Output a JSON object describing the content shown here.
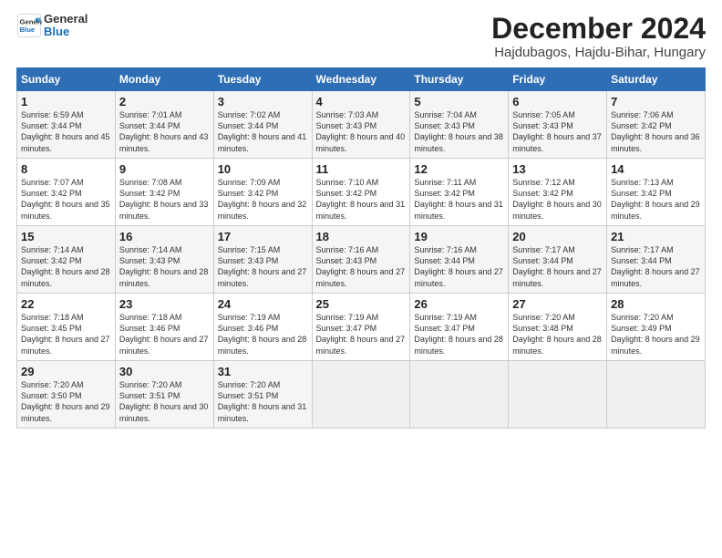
{
  "logo": {
    "text_general": "General",
    "text_blue": "Blue"
  },
  "header": {
    "month": "December 2024",
    "location": "Hajdubagos, Hajdu-Bihar, Hungary"
  },
  "weekdays": [
    "Sunday",
    "Monday",
    "Tuesday",
    "Wednesday",
    "Thursday",
    "Friday",
    "Saturday"
  ],
  "weeks": [
    [
      {
        "day": "1",
        "sunrise": "Sunrise: 6:59 AM",
        "sunset": "Sunset: 3:44 PM",
        "daylight": "Daylight: 8 hours and 45 minutes."
      },
      {
        "day": "2",
        "sunrise": "Sunrise: 7:01 AM",
        "sunset": "Sunset: 3:44 PM",
        "daylight": "Daylight: 8 hours and 43 minutes."
      },
      {
        "day": "3",
        "sunrise": "Sunrise: 7:02 AM",
        "sunset": "Sunset: 3:44 PM",
        "daylight": "Daylight: 8 hours and 41 minutes."
      },
      {
        "day": "4",
        "sunrise": "Sunrise: 7:03 AM",
        "sunset": "Sunset: 3:43 PM",
        "daylight": "Daylight: 8 hours and 40 minutes."
      },
      {
        "day": "5",
        "sunrise": "Sunrise: 7:04 AM",
        "sunset": "Sunset: 3:43 PM",
        "daylight": "Daylight: 8 hours and 38 minutes."
      },
      {
        "day": "6",
        "sunrise": "Sunrise: 7:05 AM",
        "sunset": "Sunset: 3:43 PM",
        "daylight": "Daylight: 8 hours and 37 minutes."
      },
      {
        "day": "7",
        "sunrise": "Sunrise: 7:06 AM",
        "sunset": "Sunset: 3:42 PM",
        "daylight": "Daylight: 8 hours and 36 minutes."
      }
    ],
    [
      {
        "day": "8",
        "sunrise": "Sunrise: 7:07 AM",
        "sunset": "Sunset: 3:42 PM",
        "daylight": "Daylight: 8 hours and 35 minutes."
      },
      {
        "day": "9",
        "sunrise": "Sunrise: 7:08 AM",
        "sunset": "Sunset: 3:42 PM",
        "daylight": "Daylight: 8 hours and 33 minutes."
      },
      {
        "day": "10",
        "sunrise": "Sunrise: 7:09 AM",
        "sunset": "Sunset: 3:42 PM",
        "daylight": "Daylight: 8 hours and 32 minutes."
      },
      {
        "day": "11",
        "sunrise": "Sunrise: 7:10 AM",
        "sunset": "Sunset: 3:42 PM",
        "daylight": "Daylight: 8 hours and 31 minutes."
      },
      {
        "day": "12",
        "sunrise": "Sunrise: 7:11 AM",
        "sunset": "Sunset: 3:42 PM",
        "daylight": "Daylight: 8 hours and 31 minutes."
      },
      {
        "day": "13",
        "sunrise": "Sunrise: 7:12 AM",
        "sunset": "Sunset: 3:42 PM",
        "daylight": "Daylight: 8 hours and 30 minutes."
      },
      {
        "day": "14",
        "sunrise": "Sunrise: 7:13 AM",
        "sunset": "Sunset: 3:42 PM",
        "daylight": "Daylight: 8 hours and 29 minutes."
      }
    ],
    [
      {
        "day": "15",
        "sunrise": "Sunrise: 7:14 AM",
        "sunset": "Sunset: 3:42 PM",
        "daylight": "Daylight: 8 hours and 28 minutes."
      },
      {
        "day": "16",
        "sunrise": "Sunrise: 7:14 AM",
        "sunset": "Sunset: 3:43 PM",
        "daylight": "Daylight: 8 hours and 28 minutes."
      },
      {
        "day": "17",
        "sunrise": "Sunrise: 7:15 AM",
        "sunset": "Sunset: 3:43 PM",
        "daylight": "Daylight: 8 hours and 27 minutes."
      },
      {
        "day": "18",
        "sunrise": "Sunrise: 7:16 AM",
        "sunset": "Sunset: 3:43 PM",
        "daylight": "Daylight: 8 hours and 27 minutes."
      },
      {
        "day": "19",
        "sunrise": "Sunrise: 7:16 AM",
        "sunset": "Sunset: 3:44 PM",
        "daylight": "Daylight: 8 hours and 27 minutes."
      },
      {
        "day": "20",
        "sunrise": "Sunrise: 7:17 AM",
        "sunset": "Sunset: 3:44 PM",
        "daylight": "Daylight: 8 hours and 27 minutes."
      },
      {
        "day": "21",
        "sunrise": "Sunrise: 7:17 AM",
        "sunset": "Sunset: 3:44 PM",
        "daylight": "Daylight: 8 hours and 27 minutes."
      }
    ],
    [
      {
        "day": "22",
        "sunrise": "Sunrise: 7:18 AM",
        "sunset": "Sunset: 3:45 PM",
        "daylight": "Daylight: 8 hours and 27 minutes."
      },
      {
        "day": "23",
        "sunrise": "Sunrise: 7:18 AM",
        "sunset": "Sunset: 3:46 PM",
        "daylight": "Daylight: 8 hours and 27 minutes."
      },
      {
        "day": "24",
        "sunrise": "Sunrise: 7:19 AM",
        "sunset": "Sunset: 3:46 PM",
        "daylight": "Daylight: 8 hours and 28 minutes."
      },
      {
        "day": "25",
        "sunrise": "Sunrise: 7:19 AM",
        "sunset": "Sunset: 3:47 PM",
        "daylight": "Daylight: 8 hours and 27 minutes."
      },
      {
        "day": "26",
        "sunrise": "Sunrise: 7:19 AM",
        "sunset": "Sunset: 3:47 PM",
        "daylight": "Daylight: 8 hours and 28 minutes."
      },
      {
        "day": "27",
        "sunrise": "Sunrise: 7:20 AM",
        "sunset": "Sunset: 3:48 PM",
        "daylight": "Daylight: 8 hours and 28 minutes."
      },
      {
        "day": "28",
        "sunrise": "Sunrise: 7:20 AM",
        "sunset": "Sunset: 3:49 PM",
        "daylight": "Daylight: 8 hours and 29 minutes."
      }
    ],
    [
      {
        "day": "29",
        "sunrise": "Sunrise: 7:20 AM",
        "sunset": "Sunset: 3:50 PM",
        "daylight": "Daylight: 8 hours and 29 minutes."
      },
      {
        "day": "30",
        "sunrise": "Sunrise: 7:20 AM",
        "sunset": "Sunset: 3:51 PM",
        "daylight": "Daylight: 8 hours and 30 minutes."
      },
      {
        "day": "31",
        "sunrise": "Sunrise: 7:20 AM",
        "sunset": "Sunset: 3:51 PM",
        "daylight": "Daylight: 8 hours and 31 minutes."
      },
      null,
      null,
      null,
      null
    ]
  ]
}
